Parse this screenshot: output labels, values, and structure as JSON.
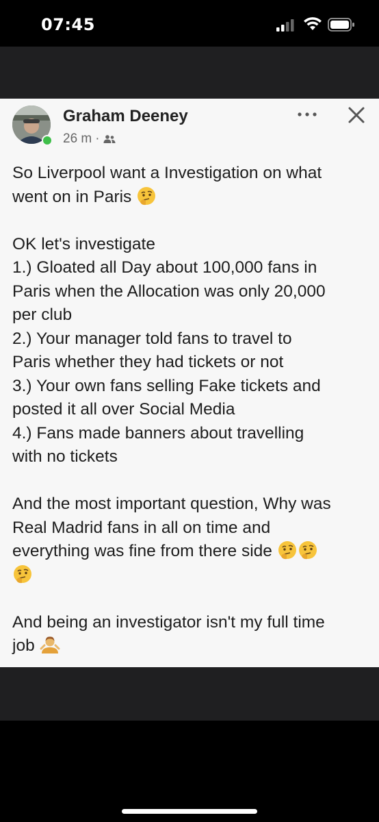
{
  "status_bar": {
    "time": "07:45",
    "icons": [
      "signal-icon",
      "wifi-icon",
      "battery-icon"
    ]
  },
  "post": {
    "author": "Graham Deeney",
    "timestamp": "26 m",
    "separator": "·",
    "audience_icon": "friends-icon",
    "more_icon": "more-dots-icon",
    "close_icon": "close-icon",
    "paragraphs": [
      {
        "lines": [
          "So Liverpool want a Investigation on what",
          "went on in Paris"
        ]
      },
      {
        "lines": [
          "OK let's investigate",
          "1.) Gloated all Day about 100,000 fans in",
          "Paris when the Allocation was only 20,000",
          "per club",
          "2.) Your manager told fans to travel to",
          "Paris whether they had tickets or not",
          "3.) Your own fans selling Fake tickets and",
          "posted it all over Social Media",
          "4.) Fans made banners about travelling",
          "with no tickets"
        ]
      },
      {
        "lines": [
          "And the most important question, Why was",
          "Real Madrid fans in all on time and",
          "everything was fine from there side"
        ]
      },
      {
        "lines": [
          "And being an investigator isn't my full time",
          "job"
        ]
      }
    ],
    "emojis": {
      "thinking": "thinking-face-icon",
      "shrug": "shrug-icon"
    }
  },
  "colors": {
    "card_bg": "#f7f7f7",
    "band_bg": "#1f1f21",
    "text": "#1c1c1c",
    "online": "#3fbf4a"
  }
}
